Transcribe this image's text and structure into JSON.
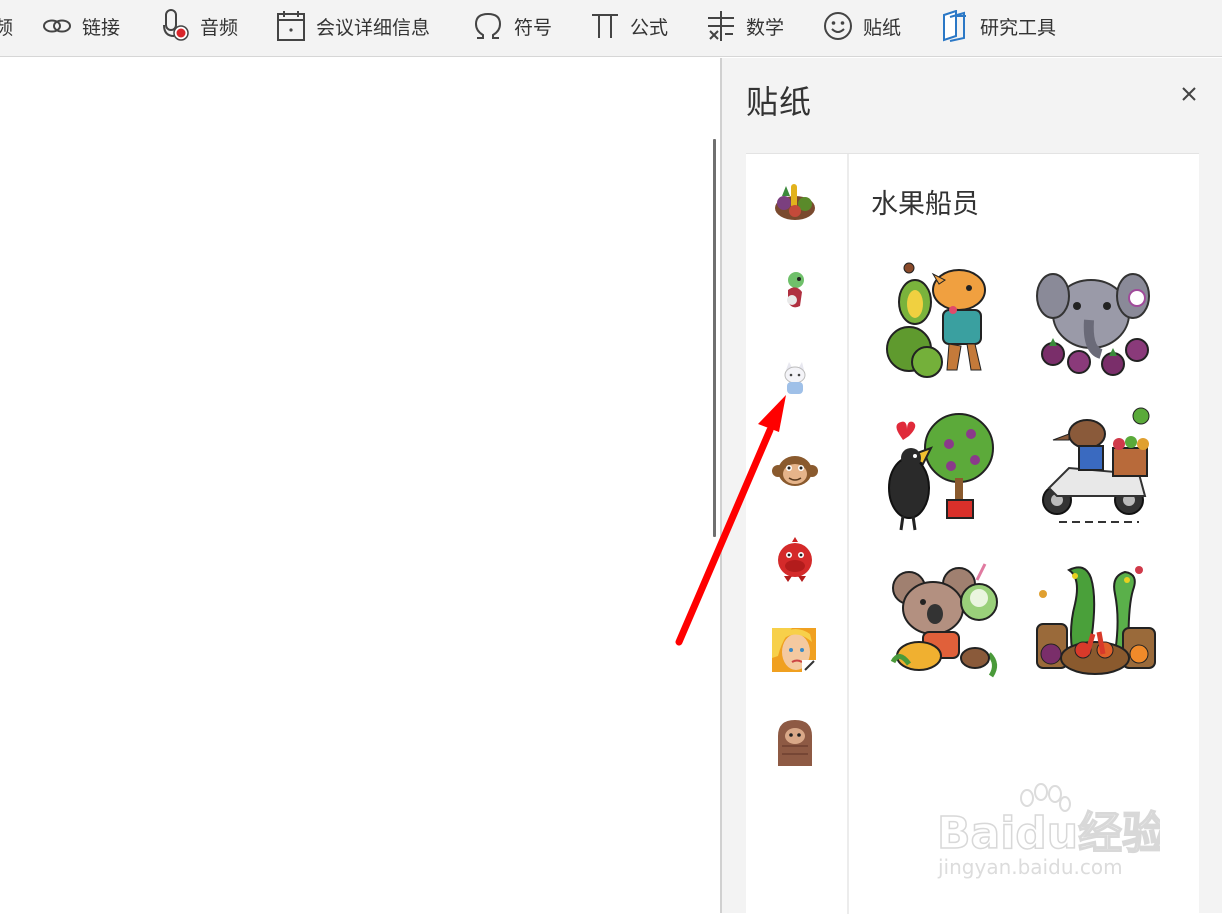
{
  "ribbon": {
    "items": [
      {
        "label": "频",
        "icon": "video-icon"
      },
      {
        "label": "链接",
        "icon": "link-icon"
      },
      {
        "label": "音频",
        "icon": "audio-icon"
      },
      {
        "label": "会议详细信息",
        "icon": "calendar-icon"
      },
      {
        "label": "符号",
        "icon": "omega-icon"
      },
      {
        "label": "公式",
        "icon": "pi-icon"
      },
      {
        "label": "数学",
        "icon": "math-icon"
      },
      {
        "label": "贴纸",
        "icon": "smiley-icon"
      },
      {
        "label": "研究工具",
        "icon": "research-icon"
      }
    ]
  },
  "pane": {
    "title": "贴纸",
    "close_icon": "close-icon",
    "categories": [
      {
        "name": "fruit-sticker-category"
      },
      {
        "name": "green-character-category"
      },
      {
        "name": "cat-character-category"
      },
      {
        "name": "monkey-face-category"
      },
      {
        "name": "red-creature-category"
      },
      {
        "name": "comic-face-category"
      },
      {
        "name": "brown-creature-category"
      }
    ],
    "pack_title": "水果船员",
    "stickers": [
      {
        "name": "durian-sticker"
      },
      {
        "name": "elephant-mangosteen-sticker"
      },
      {
        "name": "hornbill-tree-sticker"
      },
      {
        "name": "scooter-delivery-sticker"
      },
      {
        "name": "koala-coconut-sticker"
      },
      {
        "name": "snake-vegetables-sticker"
      }
    ]
  },
  "watermark": {
    "logo": "Baidu经验",
    "url": "jingyan.baidu.com"
  },
  "colors": {
    "ribbon_bg": "#f3f3f3",
    "pane_bg": "#f3f3f3",
    "annotation_arrow": "#ff0000"
  }
}
